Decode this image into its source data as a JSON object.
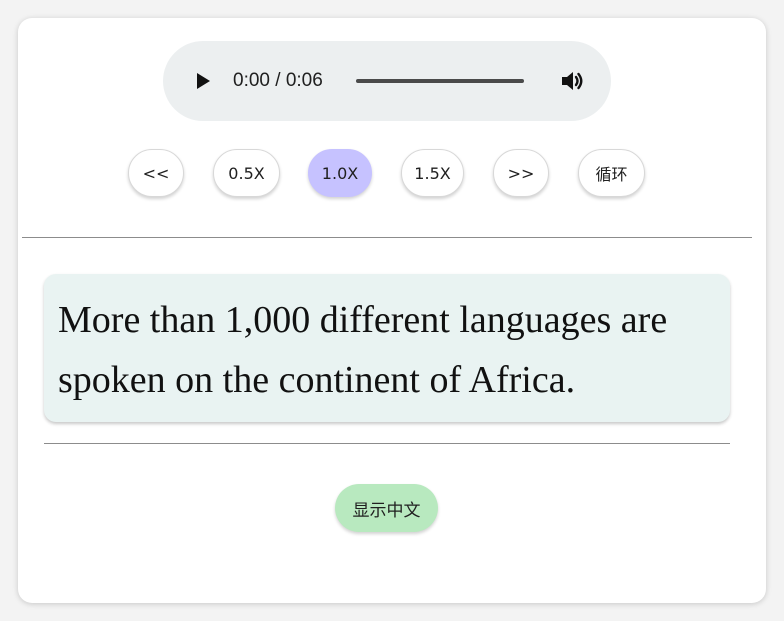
{
  "audio_player": {
    "time_display": "0:00 / 0:06",
    "playback_progress": 0,
    "icons": {
      "play": "play-icon",
      "volume": "volume-icon"
    }
  },
  "controls": {
    "prev_label": "<<",
    "speed_05_label": "0.5X",
    "speed_10_label": "1.0X",
    "speed_15_label": "1.5X",
    "next_label": ">>",
    "loop_label": "循环",
    "active_speed": "1.0X",
    "active_color": "#c6c2ff"
  },
  "sentence": {
    "text": "More than 1,000 different languages are spoken on the continent of Africa."
  },
  "show_chinese": {
    "label": "显示中文",
    "color": "#b8e9bf"
  }
}
